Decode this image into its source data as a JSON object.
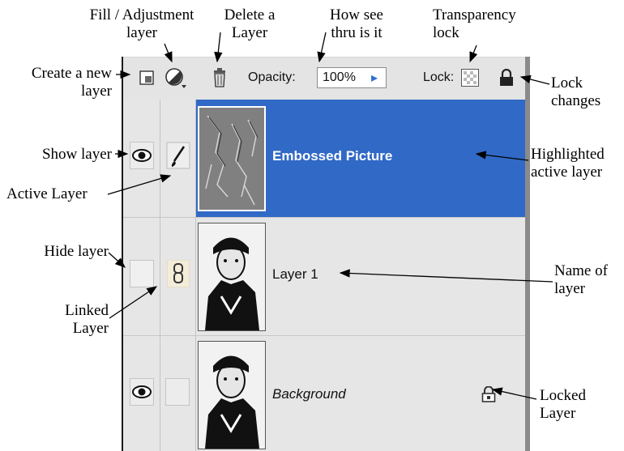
{
  "annotations": {
    "fill_adjustment": "Fill / Adjustment\nlayer",
    "delete_layer": "Delete a\nLayer",
    "how_see_thru": "How see\nthru is it",
    "transparency_lock": "Transparency\nlock",
    "create_new_layer": "Create a new\nlayer",
    "lock_changes": "Lock\nchanges",
    "show_layer": "Show layer",
    "highlighted_active": "Highlighted\nactive layer",
    "active_layer": "Active Layer",
    "hide_layer": "Hide layer",
    "name_of_layer": "Name of\nlayer",
    "linked_layer": "Linked\nLayer",
    "locked_layer": "Locked\nLayer"
  },
  "toolbar": {
    "opacity_label": "Opacity:",
    "opacity_value": "100%",
    "lock_label": "Lock:"
  },
  "layers": [
    {
      "name": "Embossed Picture",
      "visible": true,
      "active": true
    },
    {
      "name": "Layer 1",
      "visible": false,
      "linked": true
    },
    {
      "name": "Background",
      "visible": true,
      "locked": true
    }
  ],
  "colors": {
    "active_row": "#3169c6",
    "panel_bg": "#e6e6e6"
  }
}
